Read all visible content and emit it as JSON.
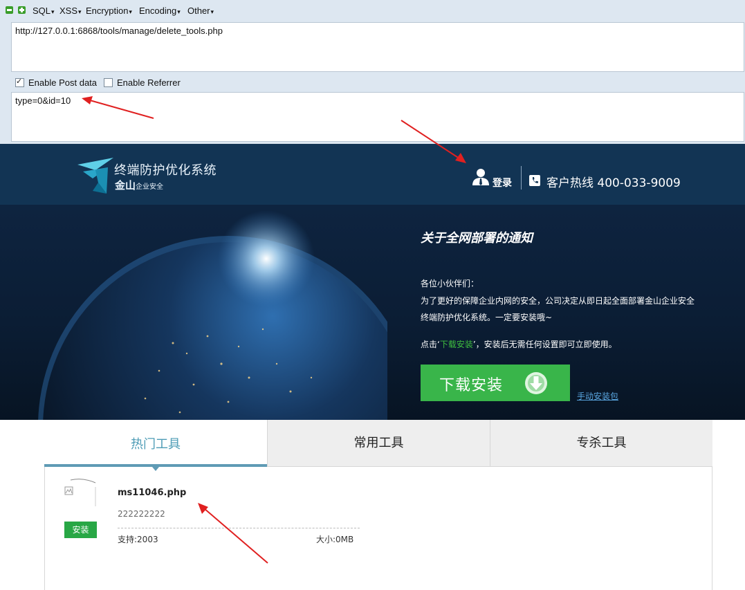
{
  "hackbar": {
    "menu": [
      "SQL",
      "XSS",
      "Encryption",
      "Encoding",
      "Other"
    ],
    "url_value": "http://127.0.0.1:6868/tools/manage/delete_tools.php",
    "enable_post_label": "Enable Post data",
    "enable_post_checked": true,
    "enable_referrer_label": "Enable Referrer",
    "enable_referrer_checked": false,
    "post_data_value": "type=0&id=10"
  },
  "header": {
    "product_title": "终端防护优化系统",
    "brand": "金山",
    "brand_sub": "企业安全",
    "login_label": "登录",
    "hotline": "客户热线 400-033-9009"
  },
  "notice": {
    "title": "关于全网部署的通知",
    "greeting": "各位小伙伴们：",
    "line1": "为了更好的保障企业内网的安全，公司决定从即日起全面部署金山企业安全",
    "line2": "终端防护优化系统。一定要安装哦~",
    "line3_prefix": "点击‘",
    "line3_highlight": "下载安装",
    "line3_suffix": "’，安装后无需任何设置即可立即使用。",
    "download_button": "下载安装",
    "manual_link": "手动安装包"
  },
  "tabs": [
    "热门工具",
    "常用工具",
    "专杀工具"
  ],
  "tool": {
    "install_label": "安装",
    "name": "ms11046.php",
    "description": "222222222",
    "support": "支持:2003",
    "size": "大小:0MB"
  },
  "colors": {
    "hackbar_bg": "#dde7f1",
    "header_bg": "#123454",
    "download_green": "#39b54a",
    "tab_active": "#4e9cb6",
    "arrow_red": "#e02020"
  }
}
